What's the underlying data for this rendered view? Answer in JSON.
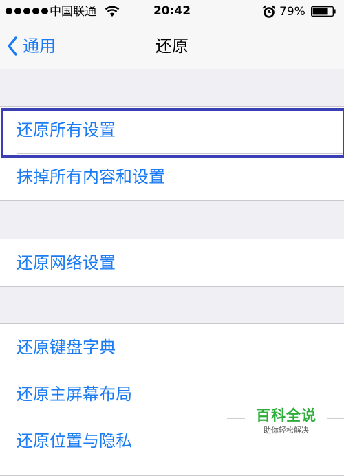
{
  "status_bar": {
    "carrier": "中国联通",
    "time": "20:42",
    "battery_percent": "79%",
    "battery_level": 0.79,
    "signal_bars": 5,
    "icons": [
      "signal-dots",
      "wifi-icon",
      "alarm-icon",
      "battery-icon"
    ]
  },
  "nav": {
    "back_label": "通用",
    "title": "还原"
  },
  "groups": [
    {
      "rows": [
        "还原所有设置",
        "抹掉所有内容和设置"
      ]
    },
    {
      "rows": [
        "还原网络设置"
      ]
    },
    {
      "rows": [
        "还原键盘字典",
        "还原主屏幕布局",
        "还原位置与隐私"
      ]
    }
  ],
  "watermark": {
    "title": "百科全说",
    "subtitle": "助你轻松解决"
  },
  "colors": {
    "accent": "#1a7bf3",
    "highlight": "#3a3fb4",
    "background": "#efeff4",
    "watermark": "#2eae3a"
  }
}
